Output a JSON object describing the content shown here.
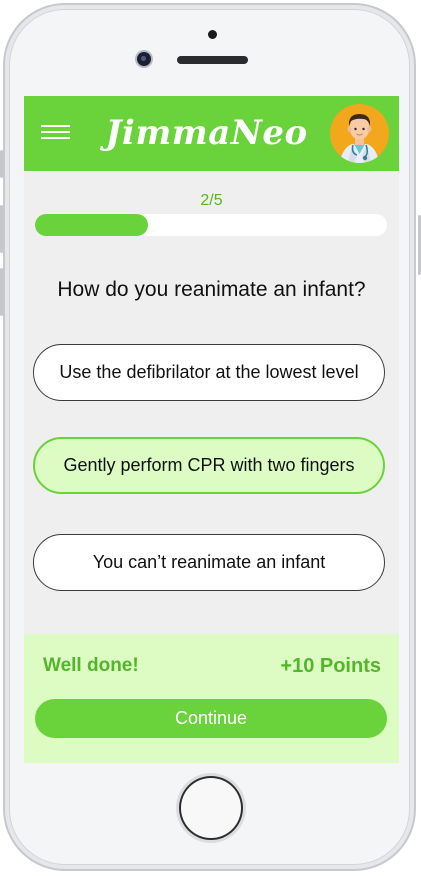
{
  "app": {
    "title": "JimmaNeo",
    "brand_color": "#6ad23a",
    "accent_text_color": "#55b52a",
    "feedback_bg": "#dcfcc4"
  },
  "header": {
    "menu_icon": "hamburger-menu-icon",
    "avatar_icon": "doctor-avatar-icon"
  },
  "progress": {
    "label": "2/5",
    "current": 2,
    "total": 5,
    "fill_fraction": 0.32
  },
  "question": {
    "text": "How do you reanimate an infant?",
    "options": [
      {
        "label": "Use the defibrilator at the lowest level",
        "selected": false
      },
      {
        "label": "Gently perform CPR with two fingers",
        "selected": true
      },
      {
        "label": "You can’t reanimate an infant",
        "selected": false
      }
    ]
  },
  "feedback": {
    "message": "Well done!",
    "points": "+10 Points",
    "continue_label": "Continue"
  }
}
